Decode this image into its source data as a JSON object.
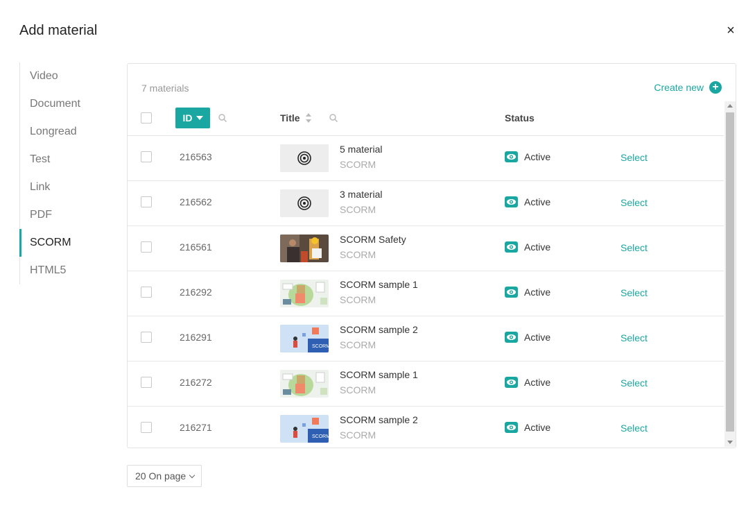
{
  "dialog": {
    "title": "Add material",
    "close": "×"
  },
  "sidebar": {
    "items": [
      {
        "label": "Video"
      },
      {
        "label": "Document"
      },
      {
        "label": "Longread"
      },
      {
        "label": "Test"
      },
      {
        "label": "Link"
      },
      {
        "label": "PDF"
      },
      {
        "label": "SCORM",
        "active": true
      },
      {
        "label": "HTML5"
      }
    ]
  },
  "panel": {
    "count": "7 materials",
    "create_new": "Create new",
    "columns": {
      "id": "ID",
      "title": "Title",
      "status": "Status"
    }
  },
  "rows": [
    {
      "id": "216563",
      "title": "5 material",
      "type": "SCORM",
      "status": "Active",
      "action": "Select",
      "thumb": "target-icon"
    },
    {
      "id": "216562",
      "title": "3 material",
      "type": "SCORM",
      "status": "Active",
      "action": "Select",
      "thumb": "target-icon"
    },
    {
      "id": "216561",
      "title": "SCORM Safety",
      "type": "SCORM",
      "status": "Active",
      "action": "Select",
      "thumb": "safety-photo"
    },
    {
      "id": "216292",
      "title": "SCORM sample 1",
      "type": "SCORM",
      "status": "Active",
      "action": "Select",
      "thumb": "sample1-illustration"
    },
    {
      "id": "216291",
      "title": "SCORM sample 2",
      "type": "SCORM",
      "status": "Active",
      "action": "Select",
      "thumb": "sample2-illustration"
    },
    {
      "id": "216272",
      "title": "SCORM sample 1",
      "type": "SCORM",
      "status": "Active",
      "action": "Select",
      "thumb": "sample1-illustration"
    },
    {
      "id": "216271",
      "title": "SCORM sample 2",
      "type": "SCORM",
      "status": "Active",
      "action": "Select",
      "thumb": "sample2-illustration"
    }
  ],
  "pagination": {
    "page_size": "20 On page"
  },
  "colors": {
    "accent": "#1aa7a1"
  }
}
